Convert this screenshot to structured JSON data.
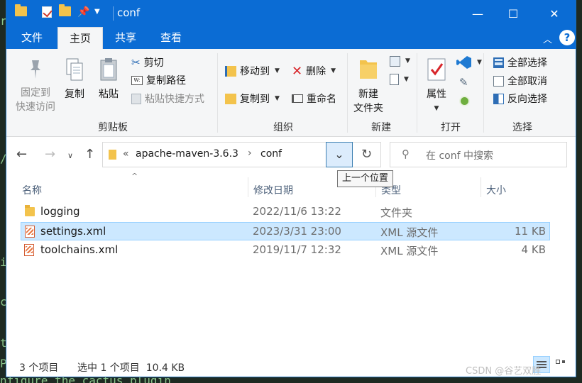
{
  "background": {
    "code_lines": [
      "r",
      "/",
      "i",
      "c",
      "t",
      "P",
      "nfigure the cactus plugin"
    ]
  },
  "titlebar": {
    "title": "conf",
    "controls": {
      "minimize": "—",
      "maximize": "☐",
      "close": "✕"
    }
  },
  "tabs": [
    "文件",
    "主页",
    "共享",
    "查看"
  ],
  "help_label": "?",
  "ribbon": {
    "clipboard": {
      "label": "剪贴板",
      "pin": [
        "固定到",
        "快速访问"
      ],
      "copy": "复制",
      "paste": "粘贴",
      "cut": "剪切",
      "copy_path": "复制路径",
      "paste_shortcut": "粘贴快捷方式"
    },
    "organize": {
      "label": "组织",
      "move_to": "移动到",
      "copy_to": "复制到",
      "delete": "删除",
      "rename": "重命名"
    },
    "new": {
      "label": "新建",
      "new_folder": [
        "新建",
        "文件夹"
      ]
    },
    "open": {
      "label": "打开",
      "properties": "属性"
    },
    "select": {
      "label": "选择",
      "select_all": "全部选择",
      "select_none": "全部取消",
      "invert": "反向选择"
    }
  },
  "address": {
    "breadcrumb": [
      "«",
      "apache-maven-3.6.3",
      "›",
      "conf"
    ],
    "search_placeholder": "在 conf 中搜索",
    "tooltip": "上一个位置"
  },
  "columns": [
    "名称",
    "修改日期",
    "类型",
    "大小"
  ],
  "files": [
    {
      "name": "logging",
      "date": "2022/11/6 13:22",
      "type": "文件夹",
      "size": "",
      "icon": "folder-icon",
      "selected": false
    },
    {
      "name": "settings.xml",
      "date": "2023/3/31 23:00",
      "type": "XML 源文件",
      "size": "11 KB",
      "icon": "xml-file-icon",
      "selected": true
    },
    {
      "name": "toolchains.xml",
      "date": "2019/11/7 12:32",
      "type": "XML 源文件",
      "size": "4 KB",
      "icon": "xml-file-icon",
      "selected": false
    }
  ],
  "status": {
    "item_count": "3 个项目",
    "selection": "选中 1 个项目  10.4 KB"
  },
  "watermark": "CSDN @谷艺双胜",
  "colors": {
    "accent": "#0b6cd4",
    "selection": "#cce8ff",
    "folder": "#f3c34c"
  }
}
